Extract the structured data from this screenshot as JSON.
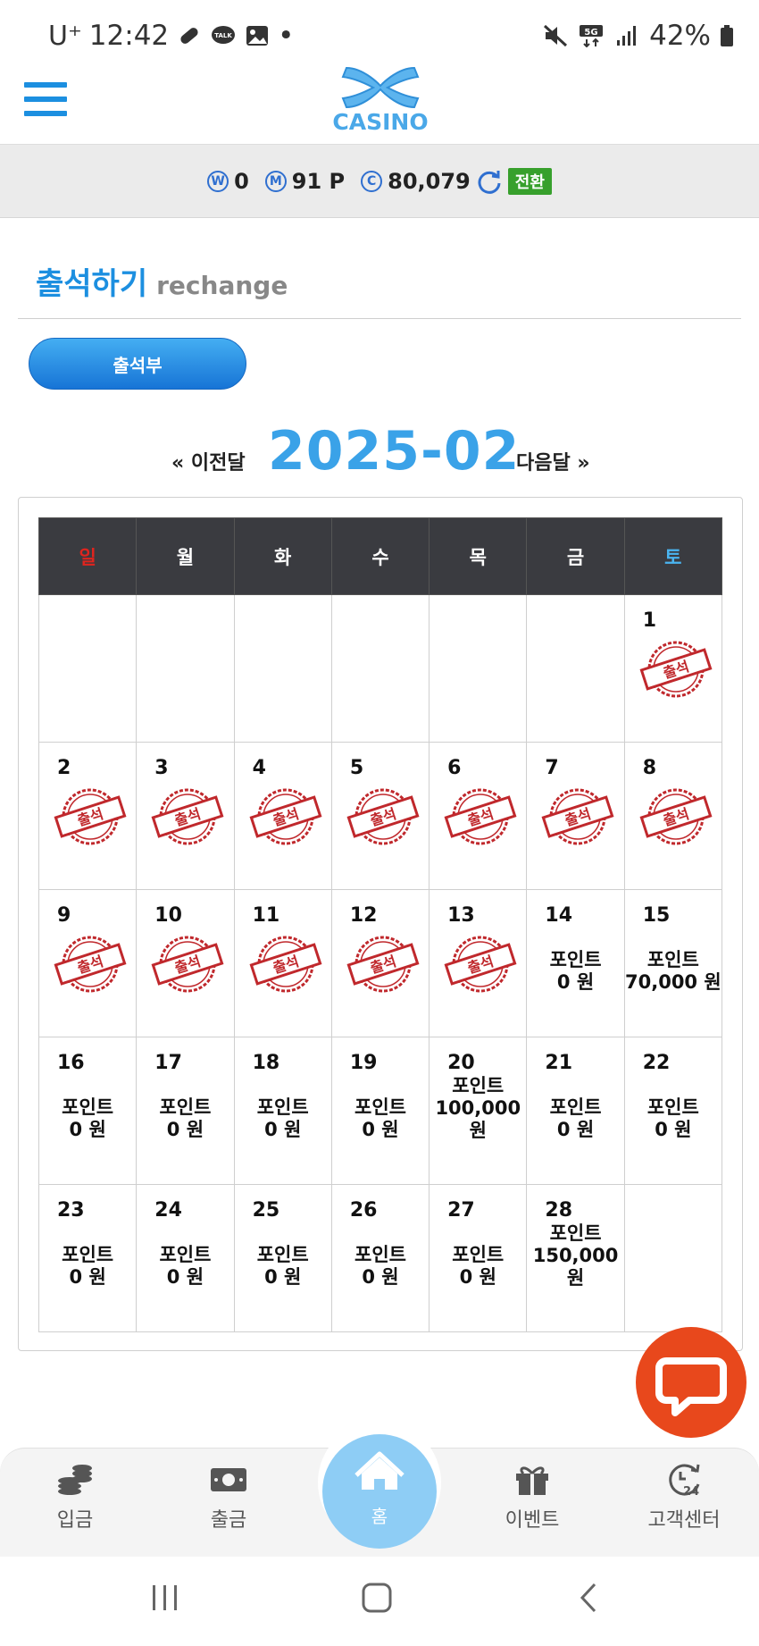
{
  "status_bar": {
    "carrier": "U⁺",
    "time": "12:42",
    "dot": "•",
    "network": "5G",
    "battery": "42%"
  },
  "header": {
    "logo_text": "CASINO"
  },
  "money_bar": {
    "w_badge": "W",
    "w_value": "0",
    "m_badge": "M",
    "m_value": "91 P",
    "c_badge": "C",
    "c_value": "80,079",
    "convert_label": "전환"
  },
  "page": {
    "title_ko": "출석하기",
    "title_en": "rechange",
    "attend_button": "출석부"
  },
  "month_nav": {
    "prev": "« 이전달",
    "month": "2025-02",
    "next": "다음달 »"
  },
  "calendar": {
    "weekdays": [
      "일",
      "월",
      "화",
      "수",
      "목",
      "금",
      "토"
    ],
    "stamp_text": "출석",
    "weeks": [
      [
        {
          "day": "",
          "stamp": false,
          "pts_label": "",
          "pts_value": ""
        },
        {
          "day": "",
          "stamp": false,
          "pts_label": "",
          "pts_value": ""
        },
        {
          "day": "",
          "stamp": false,
          "pts_label": "",
          "pts_value": ""
        },
        {
          "day": "",
          "stamp": false,
          "pts_label": "",
          "pts_value": ""
        },
        {
          "day": "",
          "stamp": false,
          "pts_label": "",
          "pts_value": ""
        },
        {
          "day": "",
          "stamp": false,
          "pts_label": "",
          "pts_value": ""
        },
        {
          "day": "1",
          "stamp": true,
          "pts_label": "",
          "pts_value": ""
        }
      ],
      [
        {
          "day": "2",
          "stamp": true,
          "pts_label": "",
          "pts_value": ""
        },
        {
          "day": "3",
          "stamp": true,
          "pts_label": "",
          "pts_value": ""
        },
        {
          "day": "4",
          "stamp": true,
          "pts_label": "",
          "pts_value": ""
        },
        {
          "day": "5",
          "stamp": true,
          "pts_label": "",
          "pts_value": ""
        },
        {
          "day": "6",
          "stamp": true,
          "pts_label": "",
          "pts_value": ""
        },
        {
          "day": "7",
          "stamp": true,
          "pts_label": "",
          "pts_value": ""
        },
        {
          "day": "8",
          "stamp": true,
          "pts_label": "",
          "pts_value": ""
        }
      ],
      [
        {
          "day": "9",
          "stamp": true,
          "pts_label": "",
          "pts_value": ""
        },
        {
          "day": "10",
          "stamp": true,
          "pts_label": "",
          "pts_value": ""
        },
        {
          "day": "11",
          "stamp": true,
          "pts_label": "",
          "pts_value": ""
        },
        {
          "day": "12",
          "stamp": true,
          "pts_label": "",
          "pts_value": ""
        },
        {
          "day": "13",
          "stamp": true,
          "pts_label": "",
          "pts_value": ""
        },
        {
          "day": "14",
          "stamp": false,
          "pts_label": "포인트",
          "pts_value": "0 원"
        },
        {
          "day": "15",
          "stamp": false,
          "pts_label": "포인트",
          "pts_value": "70,000 원"
        }
      ],
      [
        {
          "day": "16",
          "stamp": false,
          "pts_label": "포인트",
          "pts_value": "0 원"
        },
        {
          "day": "17",
          "stamp": false,
          "pts_label": "포인트",
          "pts_value": "0 원"
        },
        {
          "day": "18",
          "stamp": false,
          "pts_label": "포인트",
          "pts_value": "0 원"
        },
        {
          "day": "19",
          "stamp": false,
          "pts_label": "포인트",
          "pts_value": "0 원"
        },
        {
          "day": "20",
          "stamp": false,
          "pts_label": "포인트",
          "pts_value": "100,000 원"
        },
        {
          "day": "21",
          "stamp": false,
          "pts_label": "포인트",
          "pts_value": "0 원"
        },
        {
          "day": "22",
          "stamp": false,
          "pts_label": "포인트",
          "pts_value": "0 원"
        }
      ],
      [
        {
          "day": "23",
          "stamp": false,
          "pts_label": "포인트",
          "pts_value": "0 원"
        },
        {
          "day": "24",
          "stamp": false,
          "pts_label": "포인트",
          "pts_value": "0 원"
        },
        {
          "day": "25",
          "stamp": false,
          "pts_label": "포인트",
          "pts_value": "0 원"
        },
        {
          "day": "26",
          "stamp": false,
          "pts_label": "포인트",
          "pts_value": "0 원"
        },
        {
          "day": "27",
          "stamp": false,
          "pts_label": "포인트",
          "pts_value": "0 원"
        },
        {
          "day": "28",
          "stamp": false,
          "pts_label": "포인트",
          "pts_value": "150,000 원"
        },
        {
          "day": "",
          "stamp": false,
          "pts_label": "",
          "pts_value": ""
        }
      ]
    ]
  },
  "bottom_nav": {
    "deposit": "입금",
    "withdraw": "출금",
    "home": "홈",
    "event": "이벤트",
    "support": "고객센터",
    "support_badge": "24"
  },
  "colors": {
    "accent": "#1c8fe0",
    "month": "#3aa2e8",
    "stamp": "#c0282c",
    "chat": "#e8481c",
    "convert": "#37a02c"
  }
}
